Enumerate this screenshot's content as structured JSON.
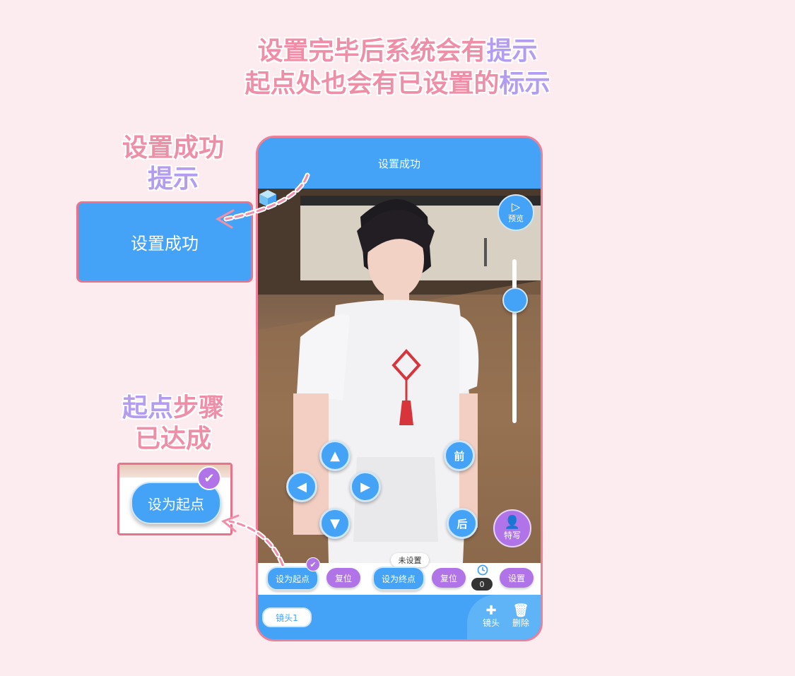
{
  "headline": {
    "line1_a": "设置完毕后系统会有",
    "line1_b": "提示",
    "line2_a": "起点处也会有已设置的",
    "line2_b": "标示"
  },
  "callouts": {
    "success_title_1": "设置成功",
    "success_title_2": "提示",
    "success_box_text": "设置成功",
    "step_title_1a": "起点",
    "step_title_1b": "步骤",
    "step_title_2": "已达成",
    "step_box_button": "设为起点"
  },
  "phone": {
    "toast": "设置成功",
    "preview_label": "预览",
    "portrait_label": "特写",
    "dpad": {
      "forward": "前",
      "back": "后"
    },
    "controls": {
      "set_start": "设为起点",
      "reset_1": "复位",
      "set_end": "设为终点",
      "reset_2": "复位",
      "settings": "设置",
      "end_status": "未设置",
      "timer_value": "0"
    },
    "bottom": {
      "shot_tab": "镜头1",
      "add_shot": "镜头",
      "delete": "删除"
    }
  },
  "colors": {
    "accent_blue": "#44a3f6",
    "accent_violet": "#b074e8",
    "frame_pink": "#ee7f97"
  }
}
